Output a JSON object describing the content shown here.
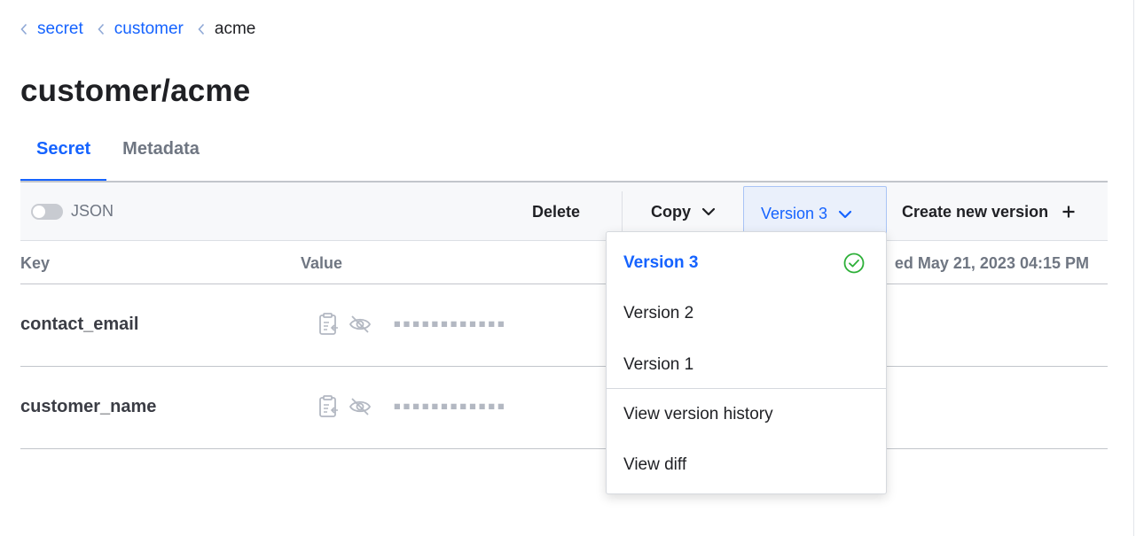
{
  "breadcrumb": {
    "items": [
      {
        "label": "secret"
      },
      {
        "label": "customer"
      },
      {
        "label": "acme"
      }
    ]
  },
  "page": {
    "title": "customer/acme"
  },
  "tabs": [
    {
      "label": "Secret",
      "active": true
    },
    {
      "label": "Metadata",
      "active": false
    }
  ],
  "toolbar": {
    "json_toggle_label": "JSON",
    "json_toggle_on": false,
    "delete_label": "Delete",
    "copy_label": "Copy",
    "version_label": "Version 3",
    "create_label": "Create new version"
  },
  "table": {
    "headers": {
      "key": "Key",
      "value": "Value",
      "created": "ed May 21, 2023 04:15 PM"
    },
    "rows": [
      {
        "key": "contact_email",
        "masked": "▪▪▪▪▪▪▪▪▪▪▪▪"
      },
      {
        "key": "customer_name",
        "masked": "▪▪▪▪▪▪▪▪▪▪▪▪"
      }
    ]
  },
  "version_menu": {
    "items": [
      {
        "label": "Version 3",
        "selected": true
      },
      {
        "label": "Version 2",
        "selected": false
      },
      {
        "label": "Version 1",
        "selected": false
      }
    ],
    "history_label": "View version history",
    "diff_label": "View diff"
  },
  "colors": {
    "accent": "#1563ff",
    "success": "#2eb039",
    "muted": "#6f7682"
  },
  "icons": {
    "breadcrumb": "chevron-left-icon",
    "copy": "chevron-down-icon",
    "create": "plus-icon",
    "copy_secret": "clipboard-icon",
    "reveal": "eye-off-icon",
    "selected_version": "check-circle-icon"
  }
}
